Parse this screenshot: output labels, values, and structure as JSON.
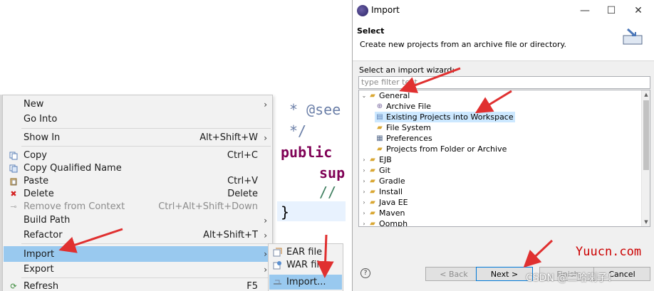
{
  "context_menu": {
    "items": [
      {
        "label": "New",
        "shortcut": "",
        "submenu": true,
        "icon": ""
      },
      {
        "label": "Go Into",
        "shortcut": "",
        "submenu": false,
        "icon": ""
      },
      {
        "label": "Show In",
        "shortcut": "Alt+Shift+W",
        "submenu": true,
        "icon": ""
      },
      {
        "label": "Copy",
        "shortcut": "Ctrl+C",
        "submenu": false,
        "icon": "copy-icon"
      },
      {
        "label": "Copy Qualified Name",
        "shortcut": "",
        "submenu": false,
        "icon": "copy-qualified-icon"
      },
      {
        "label": "Paste",
        "shortcut": "Ctrl+V",
        "submenu": false,
        "icon": "paste-icon"
      },
      {
        "label": "Delete",
        "shortcut": "Delete",
        "submenu": false,
        "icon": "delete-icon"
      },
      {
        "label": "Remove from Context",
        "shortcut": "Ctrl+Alt+Shift+Down",
        "submenu": false,
        "icon": "remove-context-icon",
        "disabled": true
      },
      {
        "label": "Build Path",
        "shortcut": "",
        "submenu": true,
        "icon": ""
      },
      {
        "label": "Refactor",
        "shortcut": "Alt+Shift+T",
        "submenu": true,
        "icon": ""
      },
      {
        "label": "Import",
        "shortcut": "",
        "submenu": true,
        "icon": "",
        "highlighted": true
      },
      {
        "label": "Export",
        "shortcut": "",
        "submenu": true,
        "icon": ""
      },
      {
        "label": "Refresh",
        "shortcut": "F5",
        "submenu": false,
        "icon": "refresh-icon"
      }
    ]
  },
  "import_submenu": {
    "items": [
      {
        "label": "EAR file",
        "icon": "ear-file-icon"
      },
      {
        "label": "WAR file",
        "icon": "war-file-icon"
      },
      {
        "label": "Import...",
        "icon": "import-icon",
        "highlighted": true
      }
    ]
  },
  "editor": {
    "lines": [
      "* @see",
      "*/",
      "public",
      "sup",
      "//",
      "}"
    ]
  },
  "dialog": {
    "title": "Import",
    "header_title": "Select",
    "header_description": "Create new projects from an archive file or directory.",
    "wizard_label": "Select an import wizard:",
    "filter_placeholder": "type filter text",
    "tree": [
      {
        "label": "General",
        "level": 0,
        "expanded": true,
        "icon": "folder-open-icon"
      },
      {
        "label": "Archive File",
        "level": 1,
        "icon": "archive-icon"
      },
      {
        "label": "Existing Projects into Workspace",
        "level": 1,
        "icon": "projects-icon",
        "selected": true
      },
      {
        "label": "File System",
        "level": 1,
        "icon": "folder-icon"
      },
      {
        "label": "Preferences",
        "level": 1,
        "icon": "preferences-icon"
      },
      {
        "label": "Projects from Folder or Archive",
        "level": 1,
        "icon": "folder-icon"
      },
      {
        "label": "EJB",
        "level": 0,
        "expanded": false,
        "icon": "folder-icon"
      },
      {
        "label": "Git",
        "level": 0,
        "expanded": false,
        "icon": "folder-icon"
      },
      {
        "label": "Gradle",
        "level": 0,
        "expanded": false,
        "icon": "folder-icon"
      },
      {
        "label": "Install",
        "level": 0,
        "expanded": false,
        "icon": "folder-icon"
      },
      {
        "label": "Java EE",
        "level": 0,
        "expanded": false,
        "icon": "folder-icon"
      },
      {
        "label": "Maven",
        "level": 0,
        "expanded": false,
        "icon": "folder-icon"
      },
      {
        "label": "Oomph",
        "level": 0,
        "expanded": false,
        "icon": "folder-icon"
      }
    ],
    "buttons": {
      "back": "< Back",
      "next": "Next >",
      "finish": "Finish",
      "cancel": "Cancel"
    }
  },
  "watermarks": {
    "site": "Yuucn.com",
    "csdn": "CSDN @二哈喇子！"
  },
  "colors": {
    "menu_highlight": "#99c9ef",
    "tree_selection": "#cce8ff",
    "annotation_arrow": "#e03030",
    "keyword": "#7f0055"
  }
}
